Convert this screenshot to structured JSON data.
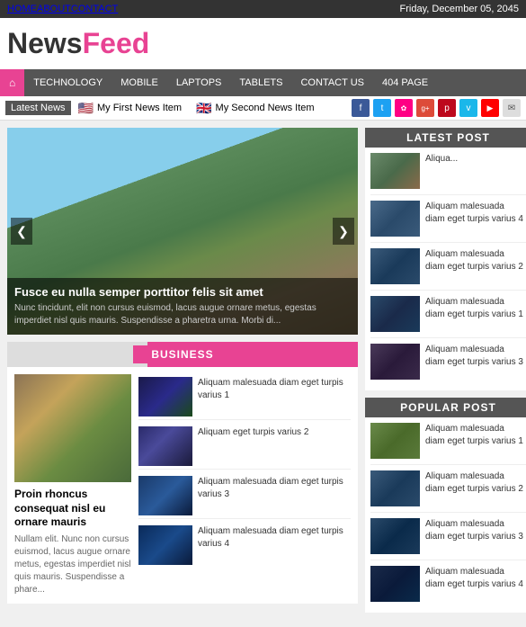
{
  "topbar": {
    "nav": [
      "HOME",
      "ABOUT",
      "CONTACT"
    ],
    "date": "Friday, December 05, 2045"
  },
  "logo": {
    "part1": "News",
    "part2": "Feed"
  },
  "nav": {
    "home_icon": "⌂",
    "items": [
      "TECHNOLOGY",
      "MOBILE",
      "LAPTOPS",
      "TABLETS",
      "CONTACT US",
      "404 PAGE"
    ]
  },
  "ticker": {
    "label": "Latest News",
    "items": [
      {
        "flag": "🇺🇸",
        "text": "My First News Item"
      },
      {
        "flag": "🇬🇧",
        "text": "My Second News Item"
      }
    ]
  },
  "social": {
    "icons": [
      "f",
      "t",
      "✿",
      "g+",
      "p",
      "v",
      "▶",
      "✉"
    ]
  },
  "slideshow": {
    "title": "Fusce eu nulla semper porttitor felis sit amet",
    "desc": "Nunc tincidunt, elit non cursus euismod, lacus augue ornare metus, egestas imperdiet nisl quis mauris. Suspendisse a pharetra urna. Morbi di..."
  },
  "business": {
    "header": "BUSINESS",
    "main_title": "Proin rhoncus consequat nisl eu ornare mauris",
    "main_desc": "Nullam elit. Nunc non cursus euismod, lacus augue ornare metus, egestas imperdiet nisl quis mauris. Suspendisse a phare...",
    "items": [
      {
        "text": "Aliquam malesuada diam eget turpis varius 1"
      },
      {
        "text": "Aliquam eget turpis varius 2"
      },
      {
        "text": "Aliquam malesuada diam eget turpis varius 3"
      },
      {
        "text": "Aliquam malesuada diam eget turpis varius 4"
      }
    ]
  },
  "latest_post": {
    "header": "LATEST POST",
    "items": [
      {
        "text": "Aliqua..."
      },
      {
        "text": "Aliquam malesuada diam eget turpis varius 4"
      },
      {
        "text": "Aliquam malesuada diam eget turpis varius 2"
      },
      {
        "text": "Aliquam malesuada diam eget turpis varius 1"
      },
      {
        "text": "Aliquam malesuada diam eget turpis varius 3"
      }
    ]
  },
  "popular_post": {
    "header": "POPULAR POST",
    "items": [
      {
        "text": "Aliquam malesuada diam eget turpis varius 1"
      },
      {
        "text": "Aliquam malesuada diam eget turpis varius 2"
      },
      {
        "text": "Aliquam malesuada diam eget turpis varius 3"
      },
      {
        "text": "Aliquam malesuada diam eget turpis varius 4"
      }
    ]
  },
  "buttons": {
    "prev": "❮",
    "next": "❯"
  }
}
